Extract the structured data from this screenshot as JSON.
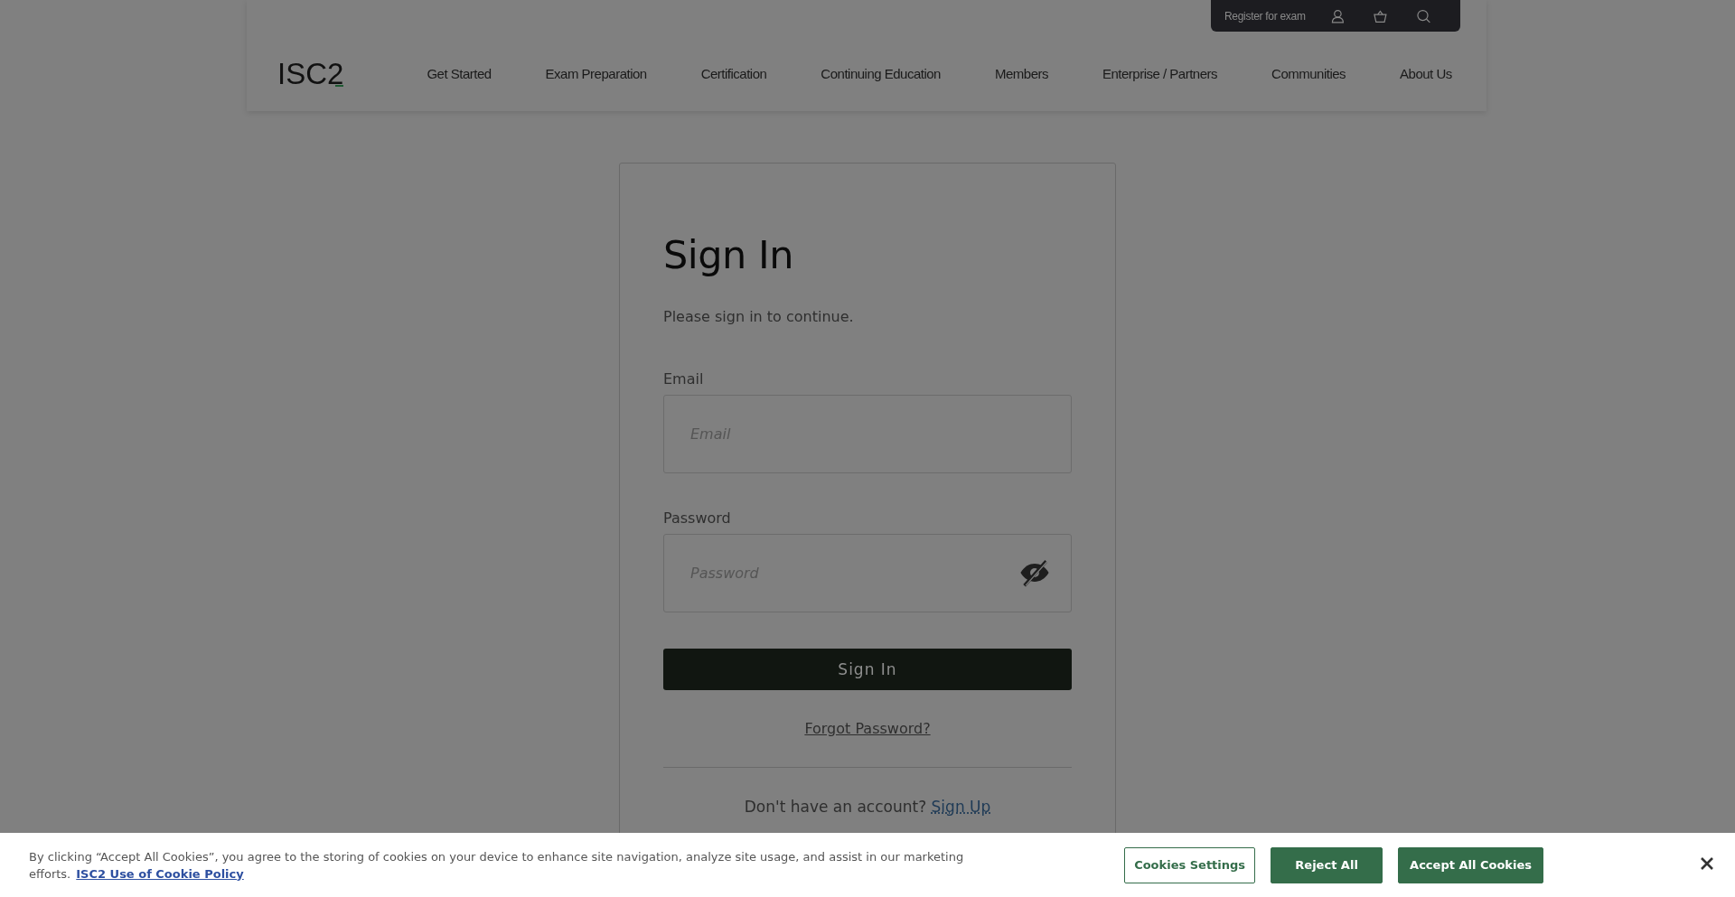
{
  "top_bar": {
    "link": "Register for exam"
  },
  "header": {
    "logo": "ISC2",
    "nav": [
      "Get Started",
      "Exam Preparation",
      "Certification",
      "Continuing Education",
      "Members",
      "Enterprise / Partners",
      "Communities",
      "About Us"
    ]
  },
  "sign_in": {
    "title": "Sign In",
    "subtitle": "Please sign in to continue.",
    "fields": [
      {
        "label": "Email",
        "placeholder": "Email",
        "kind": "text"
      },
      {
        "label": "Password",
        "placeholder": "Password",
        "kind": "password"
      }
    ],
    "submit": "Sign In",
    "forgot": "Forgot Password?",
    "signup_prompt": "Don't have an account?",
    "signup_link": "Sign Up"
  },
  "cookie_banner": {
    "text": "By clicking “Accept All Cookies”, you agree to the storing of cookies on your device to enhance site navigation, analyze site usage, and assist in our marketing efforts.",
    "policy_link": "ISC2 Use of Cookie Policy",
    "buttons": [
      {
        "label": "Cookies Settings",
        "kind": "outline"
      },
      {
        "label": "Reject All",
        "kind": "filled"
      },
      {
        "label": "Accept All Cookies",
        "kind": "filled"
      }
    ]
  }
}
